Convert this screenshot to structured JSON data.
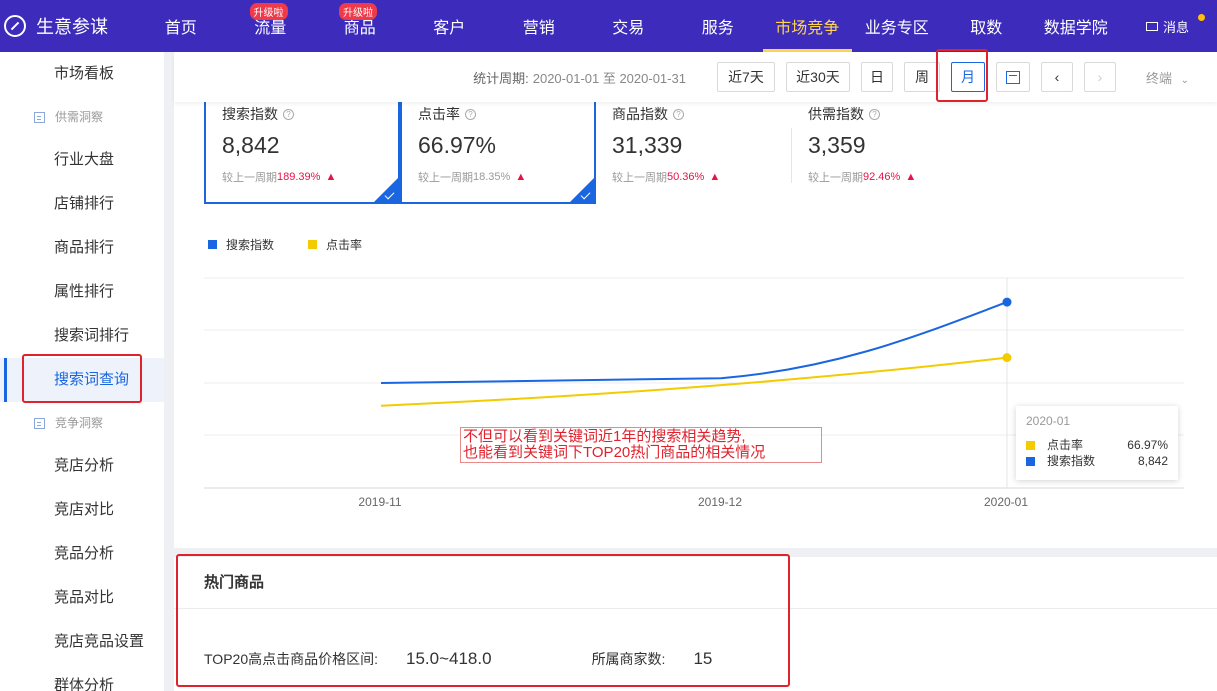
{
  "brand": {
    "name": "生意参谋",
    "icon": "compass-icon"
  },
  "nav": {
    "items": [
      {
        "label": "首页",
        "badge": ""
      },
      {
        "label": "流量",
        "badge": "升级啦"
      },
      {
        "label": "商品",
        "badge": "升级啦"
      },
      {
        "label": "客户",
        "badge": ""
      },
      {
        "label": "营销",
        "badge": ""
      },
      {
        "label": "交易",
        "badge": ""
      },
      {
        "label": "服务",
        "badge": ""
      },
      {
        "label": "市场竞争",
        "badge": "",
        "active": true
      },
      {
        "label": "业务专区",
        "badge": ""
      },
      {
        "label": "取数",
        "badge": ""
      },
      {
        "label": "数据学院",
        "badge": ""
      }
    ],
    "message_label": "消息"
  },
  "sidebar": {
    "top_item": "市场看板",
    "group1": "供需洞察",
    "group1_items": [
      "行业大盘",
      "店铺排行",
      "商品排行",
      "属性排行",
      "搜索词排行",
      "搜索词查询"
    ],
    "active_item": "搜索词查询",
    "group2": "竞争洞察",
    "group2_items": [
      "竞店分析",
      "竞店对比",
      "竞品分析",
      "竞品对比",
      "竞店竞品设置",
      "群体分析"
    ]
  },
  "filter": {
    "period_label": "统计周期:",
    "period_value": "2020-01-01 至 2020-01-31",
    "buttons": [
      "近7天",
      "近30天",
      "日",
      "周",
      "月"
    ],
    "selected": "月",
    "prev": "‹",
    "next": "›",
    "terminal_label": "终端"
  },
  "metrics": [
    {
      "name": "搜索指数",
      "value": "8,842",
      "compare_label": "较上一周期",
      "compare_pct": "189.39%",
      "selected": true
    },
    {
      "name": "点击率",
      "value": "66.97%",
      "compare_label": "较上一周期",
      "compare_pct": "18.35%",
      "selected": true
    },
    {
      "name": "商品指数",
      "value": "31,339",
      "compare_label": "较上一周期",
      "compare_pct": "50.36%",
      "selected": false
    },
    {
      "name": "供需指数",
      "value": "3,359",
      "compare_label": "较上一周期",
      "compare_pct": "92.46%",
      "selected": false
    }
  ],
  "colors": {
    "primary": "#1a66e0",
    "yellow": "#f2cc00",
    "nav_bg": "#3d2bbb",
    "highlight": "#e0222d"
  },
  "chart_data": {
    "type": "line",
    "x": [
      "2019-11",
      "2019-12",
      "2020-01"
    ],
    "series": [
      {
        "name": "搜索指数",
        "values": [
          6300,
          6450,
          8842
        ],
        "color": "#1a66e0"
      },
      {
        "name": "点击率",
        "values": [
          58.5,
          61.5,
          66.97
        ],
        "color": "#f2cc00"
      }
    ],
    "grid": true,
    "legend": "top-left",
    "tooltip": {
      "title": "2020-01",
      "rows": [
        {
          "name": "点击率",
          "value": "66.97%"
        },
        {
          "name": "搜索指数",
          "value": "8,842"
        }
      ]
    }
  },
  "annotation": "不但可以看到关键词近1年的搜索相关趋势,\n也能看到关键词下TOP20热门商品的相关情况",
  "hot": {
    "title": "热门商品",
    "price_label": "TOP20高点击商品价格区间:",
    "price_value": "15.0~418.0",
    "merchant_label": "所属商家数:",
    "merchant_value": "15"
  }
}
